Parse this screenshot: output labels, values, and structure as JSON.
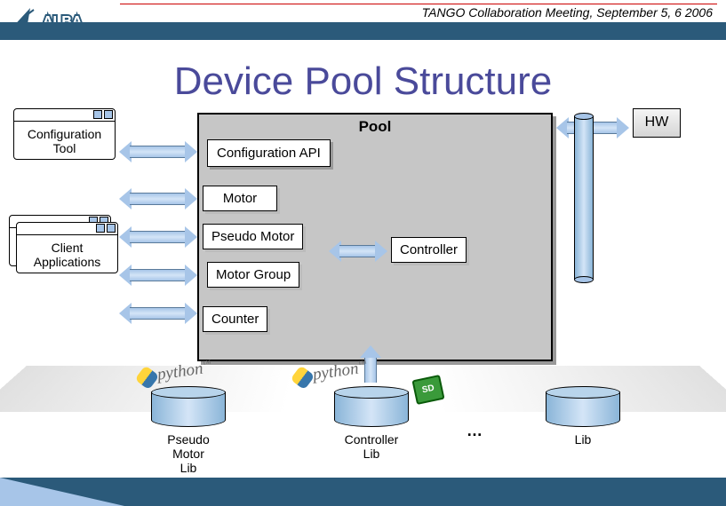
{
  "header": {
    "meeting": "TANGO Collaboration Meeting, September 5, 6 2006",
    "logo_text": "ALBA"
  },
  "title": "Device Pool Structure",
  "windows": {
    "config_tool": "Configuration Tool",
    "client_apps": "Client Applications"
  },
  "pool": {
    "label": "Pool",
    "config_api": "Configuration API",
    "motor": "Motor",
    "pseudo_motor": "Pseudo Motor",
    "motor_group": "Motor Group",
    "counter": "Counter",
    "controller": "Controller"
  },
  "hw": "HW",
  "libs": {
    "pseudo": "Pseudo Motor\nLib",
    "controller": "Controller\nLib",
    "generic": "Lib",
    "dots": "…"
  },
  "python": {
    "text": "python",
    "tm": "™"
  },
  "sd": "SD"
}
